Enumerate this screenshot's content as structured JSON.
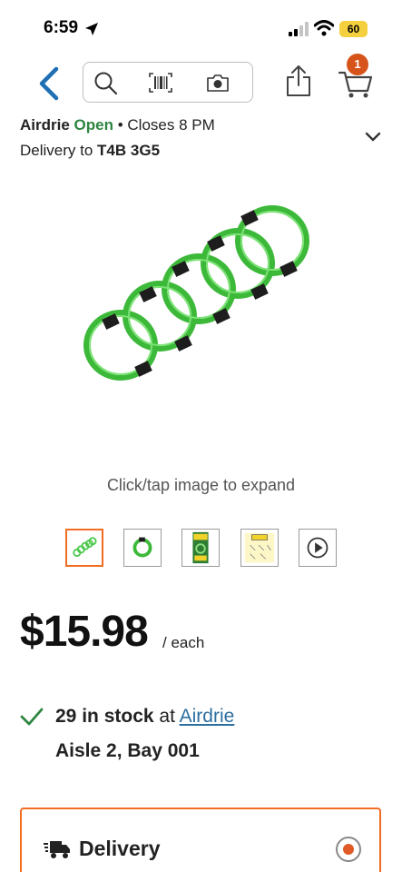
{
  "status_bar": {
    "time": "6:59",
    "battery": "60"
  },
  "header": {
    "cart_count": "1"
  },
  "store": {
    "name": "Airdrie",
    "status": "Open",
    "separator": "•",
    "closes": "Closes 8 PM",
    "delivery_prefix": "Delivery to",
    "postal_code": "T4B 3G5"
  },
  "product": {
    "image_hint": "Click/tap image to expand",
    "thumbnails": [
      "coils",
      "single-coil",
      "package-front",
      "package-back",
      "video"
    ],
    "price": "$15.98",
    "price_unit": "/ each"
  },
  "stock": {
    "count": "29 in stock",
    "at": "at",
    "store_link": "Airdrie",
    "aisle": "Aisle 2, Bay 001"
  },
  "delivery": {
    "title": "Delivery"
  },
  "colors": {
    "accent": "#f26c22",
    "open_green": "#2e8540",
    "link_blue": "#2c6fa0",
    "coil_green": "#4cc84a",
    "nav_blue": "#1f6fb5"
  }
}
